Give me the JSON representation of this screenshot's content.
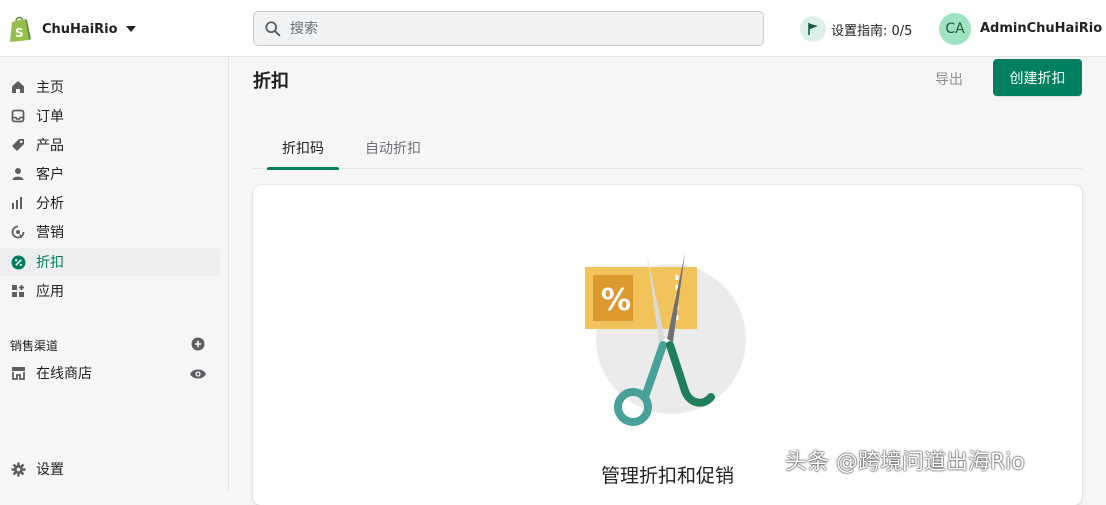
{
  "topbar": {
    "store_name": "ChuHaiRio",
    "search_placeholder": "搜索",
    "setup_guide": "设置指南: 0/5",
    "avatar_initials": "CA",
    "user_name": "AdminChuHaiRio"
  },
  "sidebar": {
    "items": [
      {
        "label": "主页",
        "icon": "home-icon"
      },
      {
        "label": "订单",
        "icon": "orders-icon"
      },
      {
        "label": "产品",
        "icon": "tag-icon"
      },
      {
        "label": "客户",
        "icon": "person-icon"
      },
      {
        "label": "分析",
        "icon": "bar-chart-icon"
      },
      {
        "label": "营销",
        "icon": "target-icon"
      },
      {
        "label": "折扣",
        "icon": "discount-icon",
        "active": true
      },
      {
        "label": "应用",
        "icon": "apps-icon"
      }
    ],
    "sales_channels_label": "销售渠道",
    "online_store_label": "在线商店",
    "settings_label": "设置"
  },
  "main": {
    "title": "折扣",
    "export_label": "导出",
    "create_label": "创建折扣",
    "tabs": [
      {
        "label": "折扣码",
        "active": true
      },
      {
        "label": "自动折扣",
        "active": false
      }
    ],
    "empty_state_title": "管理折扣和促销"
  },
  "watermark": "头条 @跨境问道出海Rio",
  "colors": {
    "accent": "#008060",
    "background": "#f6f6f7",
    "card": "#ffffff"
  }
}
